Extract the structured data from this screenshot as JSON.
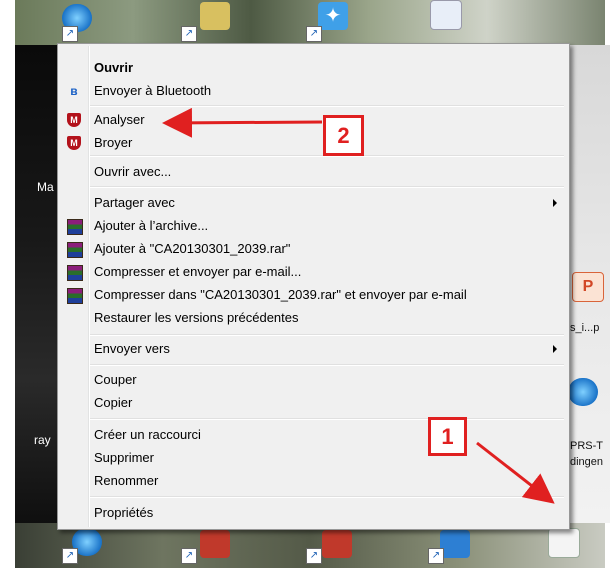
{
  "menu": {
    "items": [
      {
        "id": "ouvrir",
        "label": "Ouvrir",
        "bold": true,
        "icon": null,
        "submenu": false
      },
      {
        "id": "bluetooth",
        "label": "Envoyer à Bluetooth",
        "icon": "bluetooth-icon",
        "submenu": false
      },
      {
        "id": "analyser",
        "label": "Analyser",
        "icon": "mcafee-icon",
        "submenu": false
      },
      {
        "id": "broyer",
        "label": "Broyer",
        "icon": "mcafee-icon",
        "submenu": false
      },
      {
        "id": "ouvrir-avec",
        "label": "Ouvrir avec...",
        "icon": null,
        "submenu": false
      },
      {
        "id": "partager",
        "label": "Partager avec",
        "icon": null,
        "submenu": true
      },
      {
        "id": "ajouter-archive",
        "label": "Ajouter à l’archive...",
        "icon": "winrar-icon",
        "submenu": false
      },
      {
        "id": "ajouter-rar",
        "label": "Ajouter à \"CA20130301_2039.rar\"",
        "icon": "winrar-icon",
        "submenu": false
      },
      {
        "id": "compresser-email",
        "label": "Compresser et envoyer par e-mail...",
        "icon": "winrar-icon",
        "submenu": false
      },
      {
        "id": "compresser-rar-email",
        "label": "Compresser dans \"CA20130301_2039.rar\" et envoyer par e-mail",
        "icon": "winrar-icon",
        "submenu": false
      },
      {
        "id": "restaurer",
        "label": "Restaurer les versions précédentes",
        "icon": null,
        "submenu": false
      },
      {
        "id": "envoyer-vers",
        "label": "Envoyer vers",
        "icon": null,
        "submenu": true
      },
      {
        "id": "couper",
        "label": "Couper",
        "icon": null,
        "submenu": false
      },
      {
        "id": "copier",
        "label": "Copier",
        "icon": null,
        "submenu": false
      },
      {
        "id": "creer-raccourci",
        "label": "Créer un raccourci",
        "icon": null,
        "submenu": false
      },
      {
        "id": "supprimer",
        "label": "Supprimer",
        "icon": null,
        "submenu": false
      },
      {
        "id": "renommer",
        "label": "Renommer",
        "icon": null,
        "submenu": false
      },
      {
        "id": "proprietes",
        "label": "Propriétés",
        "icon": null,
        "submenu": false
      }
    ]
  },
  "annotations": {
    "badge_1": "1",
    "badge_2": "2",
    "color": "#e02020"
  },
  "desktop": {
    "labels": {
      "left_ma": "Ma",
      "left_ray": "ray",
      "right_ppt": "s_i...p",
      "right_prs": "PRS-T",
      "right_ing": "dingen"
    }
  }
}
